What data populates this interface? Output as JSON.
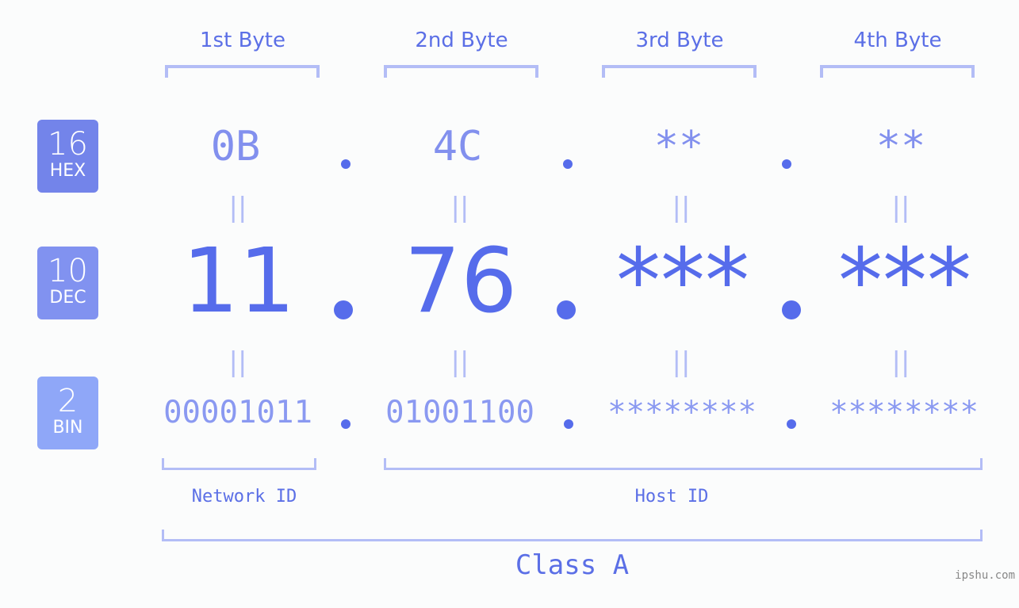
{
  "byte_headers": [
    "1st Byte",
    "2nd Byte",
    "3rd Byte",
    "4th Byte"
  ],
  "badges": [
    {
      "number": "16",
      "label": "HEX",
      "color": "#7384ea"
    },
    {
      "number": "10",
      "label": "DEC",
      "color": "#8192f0"
    },
    {
      "number": "2",
      "label": "BIN",
      "color": "#8fa7f8"
    }
  ],
  "hex": [
    "0B",
    "4C",
    "**",
    "**"
  ],
  "dec": [
    "11",
    "76",
    "***",
    "***"
  ],
  "bin": [
    "00001011",
    "01001100",
    "********",
    "********"
  ],
  "equals_symbol": "||",
  "network_id_label": "Network ID",
  "host_id_label": "Host ID",
  "class_label": "Class A",
  "watermark": "ipshu.com",
  "colors": {
    "accent": "#566ceb",
    "bracket": "#b3bdf6",
    "background": "#fbfcfc"
  }
}
